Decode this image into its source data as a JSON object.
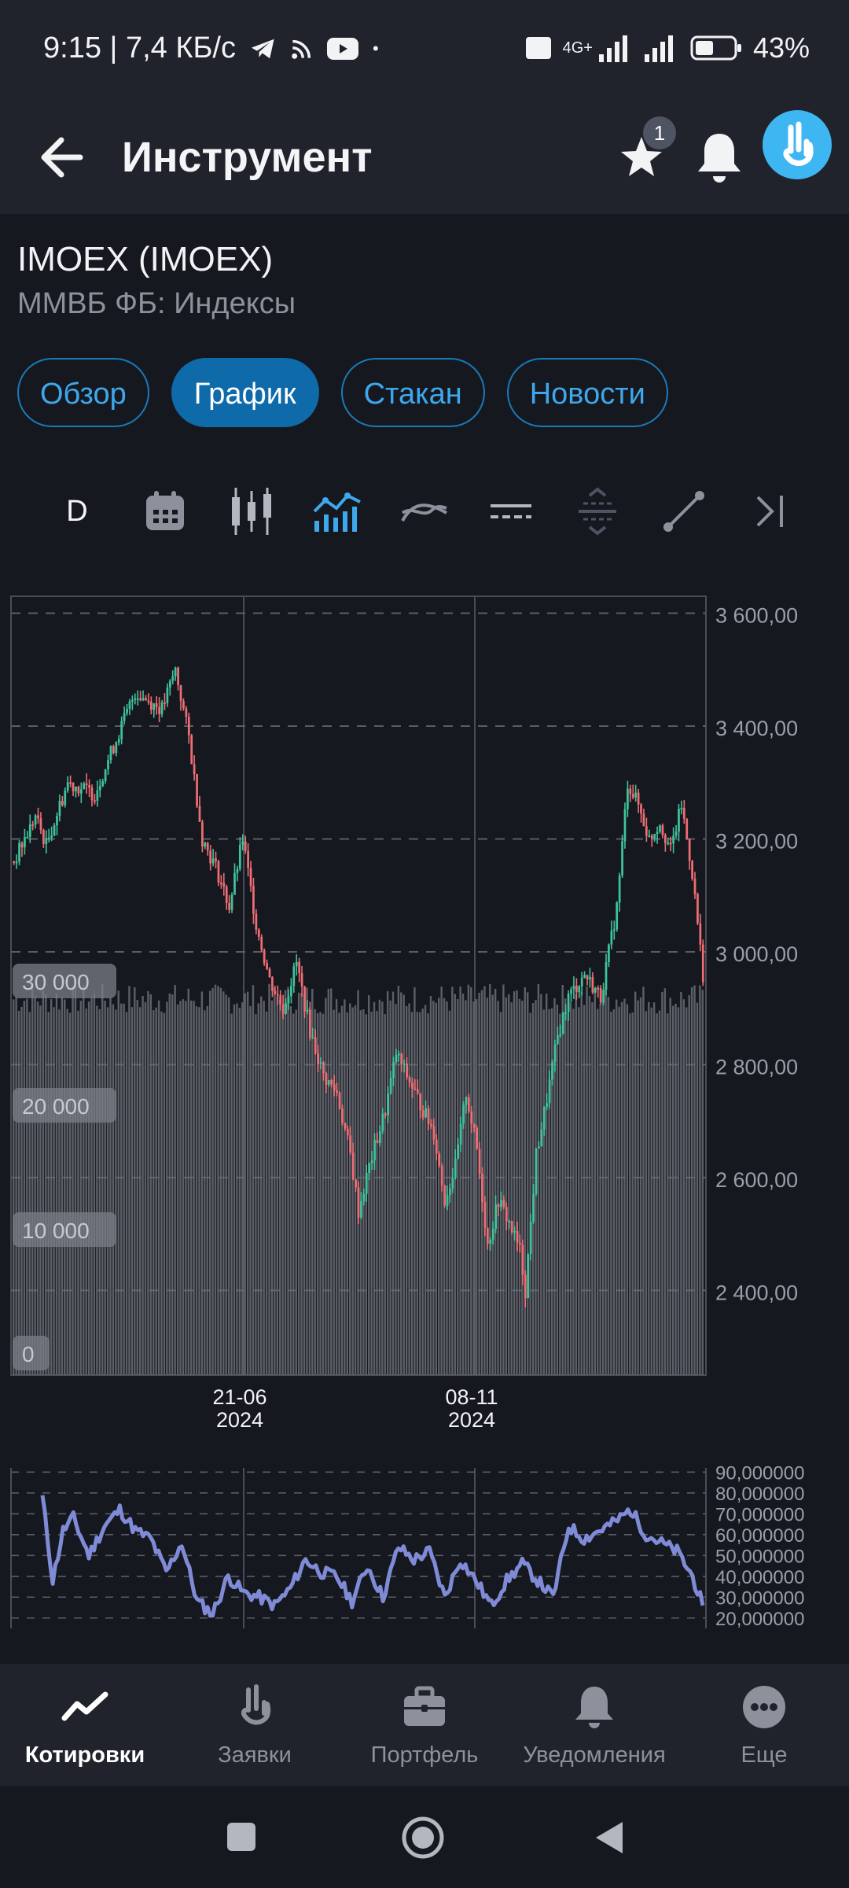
{
  "status": {
    "time_speed": "9:15 | 7,4 КБ/с",
    "network": "4G+",
    "battery": "43%"
  },
  "appbar": {
    "title": "Инструмент",
    "favorites_badge": "1"
  },
  "instrument": {
    "title": "IMOEX (IMOEX)",
    "subtitle": "ММВБ ФБ: Индексы"
  },
  "tabs": [
    {
      "label": "Обзор",
      "active": false
    },
    {
      "label": "График",
      "active": true
    },
    {
      "label": "Стакан",
      "active": false
    },
    {
      "label": "Новости",
      "active": false
    }
  ],
  "toolbar": {
    "period": "D",
    "icons": [
      "calendar-icon",
      "candles-icon",
      "indicators-icon",
      "overlay-icon",
      "hlines-icon",
      "levels-icon",
      "trendline-icon",
      "go-to-end-icon"
    ]
  },
  "colors": {
    "up": "#3ec49a",
    "down": "#ee6e73",
    "volume": "#6a6c74",
    "rsi": "#7f8bd6",
    "accent": "#0e6aa8"
  },
  "chart_data": [
    {
      "type": "candlestick",
      "price_ticks": [
        "3 600,00",
        "3 400,00",
        "3 200,00",
        "3 000,00",
        "2 800,00",
        "2 600,00",
        "2 400,00"
      ],
      "price_ylim": [
        2250,
        3630
      ],
      "volume_ticks": [
        "30 000",
        "20 000",
        "10 000",
        "0"
      ],
      "x_ticks": [
        {
          "date": "21-06",
          "year": "2024"
        },
        {
          "date": "08-11",
          "year": "2024"
        }
      ],
      "close_path": [
        [
          0,
          3160
        ],
        [
          8,
          3240
        ],
        [
          12,
          3190
        ],
        [
          20,
          3300
        ],
        [
          30,
          3280
        ],
        [
          40,
          3400
        ],
        [
          45,
          3460
        ],
        [
          55,
          3430
        ],
        [
          60,
          3500
        ],
        [
          65,
          3380
        ],
        [
          70,
          3200
        ],
        [
          75,
          3150
        ],
        [
          80,
          3080
        ],
        [
          85,
          3200
        ],
        [
          90,
          3050
        ],
        [
          95,
          2950
        ],
        [
          100,
          2900
        ],
        [
          105,
          2980
        ],
        [
          110,
          2860
        ],
        [
          115,
          2780
        ],
        [
          120,
          2750
        ],
        [
          125,
          2640
        ],
        [
          128,
          2540
        ],
        [
          132,
          2620
        ],
        [
          138,
          2720
        ],
        [
          142,
          2820
        ],
        [
          148,
          2760
        ],
        [
          152,
          2720
        ],
        [
          156,
          2680
        ],
        [
          160,
          2560
        ],
        [
          164,
          2620
        ],
        [
          168,
          2750
        ],
        [
          172,
          2650
        ],
        [
          176,
          2480
        ],
        [
          180,
          2560
        ],
        [
          184,
          2520
        ],
        [
          188,
          2470
        ],
        [
          190,
          2400
        ],
        [
          194,
          2640
        ],
        [
          198,
          2740
        ],
        [
          202,
          2850
        ],
        [
          206,
          2920
        ],
        [
          212,
          2960
        ],
        [
          218,
          2920
        ],
        [
          224,
          3080
        ],
        [
          228,
          3300
        ],
        [
          232,
          3260
        ],
        [
          236,
          3200
        ],
        [
          240,
          3230
        ],
        [
          244,
          3180
        ],
        [
          248,
          3260
        ],
        [
          252,
          3140
        ],
        [
          256,
          2960
        ]
      ],
      "volume": 28000
    },
    {
      "type": "line",
      "name": "rsi",
      "ticks": [
        "90,000000",
        "80,000000",
        "70,000000",
        "60,000000",
        "50,000000",
        "40,000000",
        "30,000000",
        "20,000000"
      ],
      "ylim": [
        15,
        92
      ],
      "values": [
        [
          0,
          78
        ],
        [
          4,
          38
        ],
        [
          8,
          62
        ],
        [
          12,
          68
        ],
        [
          18,
          50
        ],
        [
          24,
          64
        ],
        [
          30,
          72
        ],
        [
          36,
          62
        ],
        [
          42,
          58
        ],
        [
          48,
          42
        ],
        [
          54,
          56
        ],
        [
          60,
          28
        ],
        [
          66,
          22
        ],
        [
          72,
          40
        ],
        [
          78,
          32
        ],
        [
          84,
          30
        ],
        [
          90,
          26
        ],
        [
          96,
          34
        ],
        [
          102,
          48
        ],
        [
          108,
          42
        ],
        [
          114,
          40
        ],
        [
          120,
          28
        ],
        [
          126,
          45
        ],
        [
          132,
          30
        ],
        [
          138,
          54
        ],
        [
          144,
          48
        ],
        [
          150,
          52
        ],
        [
          156,
          30
        ],
        [
          162,
          48
        ],
        [
          168,
          38
        ],
        [
          174,
          26
        ],
        [
          180,
          38
        ],
        [
          186,
          46
        ],
        [
          192,
          38
        ],
        [
          198,
          30
        ],
        [
          204,
          64
        ],
        [
          210,
          58
        ],
        [
          216,
          62
        ],
        [
          222,
          66
        ],
        [
          228,
          72
        ],
        [
          234,
          60
        ],
        [
          240,
          56
        ],
        [
          246,
          52
        ],
        [
          252,
          40
        ],
        [
          256,
          26
        ]
      ]
    }
  ],
  "bottom_nav": [
    {
      "label": "Котировки",
      "icon": "quotes-icon",
      "active": true
    },
    {
      "label": "Заявки",
      "icon": "orders-icon",
      "active": false
    },
    {
      "label": "Портфель",
      "icon": "portfolio-icon",
      "active": false
    },
    {
      "label": "Уведомления",
      "icon": "notifications-icon",
      "active": false
    },
    {
      "label": "Еще",
      "icon": "more-icon",
      "active": false
    }
  ]
}
